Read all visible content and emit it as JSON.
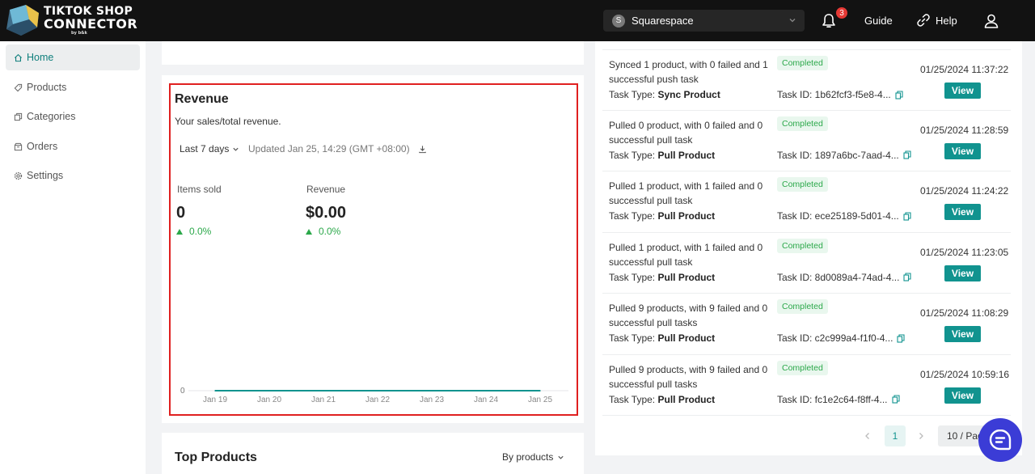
{
  "header": {
    "logo_line1": "TIKTOK SHOP",
    "logo_line2": "CONNECTOR",
    "logo_line3": "by b&k",
    "store_avatar_letter": "S",
    "store_name": "Squarespace",
    "notification_count": "3",
    "guide_label": "Guide",
    "help_label": "Help"
  },
  "sidebar": {
    "items": [
      {
        "label": "Home",
        "icon": "home-icon"
      },
      {
        "label": "Products",
        "icon": "tag-icon"
      },
      {
        "label": "Categories",
        "icon": "copy-icon"
      },
      {
        "label": "Orders",
        "icon": "orders-icon"
      },
      {
        "label": "Settings",
        "icon": "gear-icon"
      }
    ]
  },
  "revenue": {
    "title": "Revenue",
    "subtitle": "Your sales/total revenue.",
    "range_label": "Last 7 days",
    "updated_text": "Updated Jan 25, 14:29 (GMT +08:00)",
    "metrics": [
      {
        "label": "Items sold",
        "value": "0",
        "delta": "0.0%"
      },
      {
        "label": "Revenue",
        "value": "$0.00",
        "delta": "0.0%"
      }
    ]
  },
  "chart_data": {
    "type": "line",
    "x": [
      "Jan 19",
      "Jan 20",
      "Jan 21",
      "Jan 22",
      "Jan 23",
      "Jan 24",
      "Jan 25"
    ],
    "series": [
      {
        "values": [
          0,
          0,
          0,
          0,
          0,
          0,
          0
        ]
      }
    ],
    "y_ticks": [
      "0"
    ],
    "color": "#11938f"
  },
  "top_products": {
    "title": "Top Products",
    "filter_label": "By products"
  },
  "tasks": [
    {
      "desc": "Synced 1 product, with 0 failed and 1 successful push task",
      "type_label": "Task Type:",
      "type": "Sync Product",
      "status": "Completed",
      "task_id": "Task ID: 1b62fcf3-f5e8-4...",
      "time": "01/25/2024 11:37:22",
      "view_label": "View"
    },
    {
      "desc": "Pulled 0 product, with 0 failed and 0 successful pull task",
      "type_label": "Task Type:",
      "type": "Pull Product",
      "status": "Completed",
      "task_id": "Task ID: 1897a6bc-7aad-4...",
      "time": "01/25/2024 11:28:59",
      "view_label": "View"
    },
    {
      "desc": "Pulled 1 product, with 1 failed and 0 successful pull task",
      "type_label": "Task Type:",
      "type": "Pull Product",
      "status": "Completed",
      "task_id": "Task ID: ece25189-5d01-4...",
      "time": "01/25/2024 11:24:22",
      "view_label": "View"
    },
    {
      "desc": "Pulled 1 product, with 1 failed and 0 successful pull task",
      "type_label": "Task Type:",
      "type": "Pull Product",
      "status": "Completed",
      "task_id": "Task ID: 8d0089a4-74ad-4...",
      "time": "01/25/2024 11:23:05",
      "view_label": "View"
    },
    {
      "desc": "Pulled 9 products, with 9 failed and 0 successful pull tasks",
      "type_label": "Task Type:",
      "type": "Pull Product",
      "status": "Completed",
      "task_id": "Task ID: c2c999a4-f1f0-4...",
      "time": "01/25/2024 11:08:29",
      "view_label": "View"
    },
    {
      "desc": "Pulled 9 products, with 9 failed and 0 successful pull tasks",
      "type_label": "Task Type:",
      "type": "Pull Product",
      "status": "Completed",
      "task_id": "Task ID: fc1e2c64-f8ff-4...",
      "time": "01/25/2024 10:59:16",
      "view_label": "View"
    }
  ],
  "pagination": {
    "current_page": "1",
    "page_size": "10 / Page"
  },
  "colors": {
    "accent": "#11938f",
    "highlight_border": "#e02020",
    "success": "#2ba84a",
    "chat_button": "#3b3cd6"
  }
}
